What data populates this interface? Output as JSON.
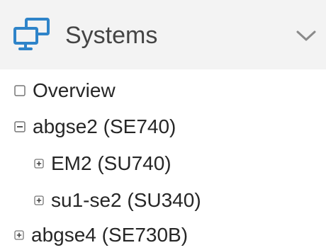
{
  "header": {
    "title": "Systems",
    "icon": "monitor-network-icon",
    "collapse_icon": "chevron-down-icon",
    "accent_color": "#2f84c9"
  },
  "tree": {
    "items": [
      {
        "label": "Overview",
        "toggle": "checkbox-empty"
      },
      {
        "label": "abgse2 (SE740)",
        "toggle": "collapse-minus"
      },
      {
        "label": "EM2 (SU740)",
        "toggle": "expand-plus"
      },
      {
        "label": "su1-se2 (SU340)",
        "toggle": "expand-plus"
      },
      {
        "label": "abgse4 (SE730B)",
        "toggle": "expand-plus"
      }
    ]
  }
}
